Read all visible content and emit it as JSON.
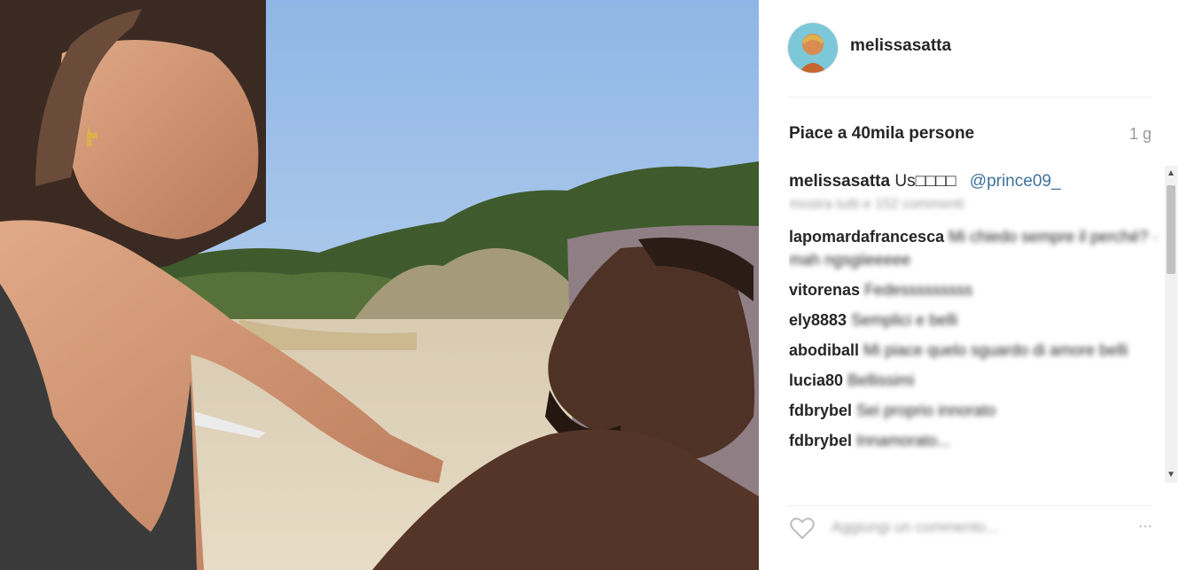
{
  "post": {
    "username": "melissasatta",
    "likes_text": "Piace a 40mila persone",
    "time": "1 g",
    "caption": {
      "username": "melissasatta",
      "text": "Us□□□□",
      "mention": "@prince09_"
    },
    "more_comments": "mostra tutti e 152 commenti",
    "comments": [
      {
        "user": "lapomardafrancesca",
        "text": "Mi chiedo sempre il perché? · mah ngsgiieeeee"
      },
      {
        "user": "vitorenas",
        "text": "Fedesssssssss"
      },
      {
        "user": "ely8883",
        "text": "Semplici e belli"
      },
      {
        "user": "abodiball",
        "text": "Mi piace quelo sguardo di amore belli"
      },
      {
        "user": "lucia80",
        "text": "Bellissimi"
      },
      {
        "user": "fdbrybel",
        "text": "Sei proprio innorato"
      },
      {
        "user": "fdbrybel",
        "text": "Innamorato..."
      }
    ],
    "add_comment_placeholder": "Aggiungi un commento...",
    "more_icon": "···",
    "icons": [
      "heart-icon",
      "more-icon"
    ]
  }
}
